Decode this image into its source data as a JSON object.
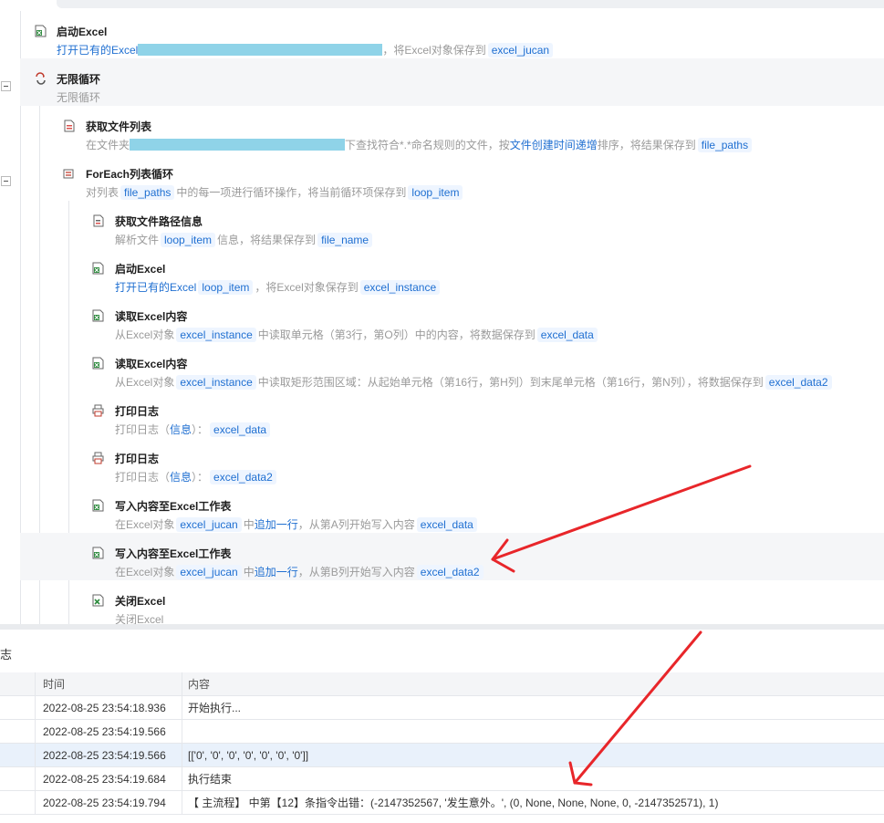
{
  "steps": [
    {
      "title": "启动Excel",
      "pre": "打开已有的Excel",
      "post": "，将Excel对象保存到",
      "tag": "excel_jucan"
    },
    {
      "title": "无限循环",
      "desc": "无限循环"
    },
    {
      "title": "获取文件列表",
      "pre": "在文件夹",
      "post": "下查找符合*.*命名规则的文件，按",
      "link": "文件创建时间递增",
      "post2": "排序，将结果保存到",
      "tag": "file_paths"
    },
    {
      "title": "ForEach列表循环",
      "pre": "对列表",
      "tag1": "file_paths",
      "mid": "中的每一项进行循环操作，将当前循环项保存到",
      "tag2": "loop_item"
    },
    {
      "title": "获取文件路径信息",
      "pre": "解析文件",
      "tag1": "loop_item",
      "mid": "信息，将结果保存到",
      "tag2": "file_name"
    },
    {
      "title": "启动Excel",
      "pre": "打开已有的Excel",
      "tag1": "loop_item",
      "mid": "，将Excel对象保存到",
      "tag2": "excel_instance"
    },
    {
      "title": "读取Excel内容",
      "pre": "从Excel对象",
      "tag1": "excel_instance",
      "mid": "中读取单元格（第3行，第O列）中的内容，将数据保存到",
      "tag2": "excel_data"
    },
    {
      "title": "读取Excel内容",
      "pre": "从Excel对象",
      "tag1": "excel_instance",
      "mid": "中读取矩形范围区域：从起始单元格（第16行，第H列）到末尾单元格（第16行，第N列），将数据保存到",
      "tag2": "excel_data2"
    },
    {
      "title": "打印日志",
      "pre": "打印日志（",
      "link": "信息",
      "mid": "）：",
      "tag": "excel_data"
    },
    {
      "title": "打印日志",
      "pre": "打印日志（",
      "link": "信息",
      "mid": "）：",
      "tag": "excel_data2"
    },
    {
      "title": "写入内容至Excel工作表",
      "pre": "在Excel对象",
      "tag1": "excel_jucan",
      "mid": "中",
      "link": "追加一行",
      "mid2": "，从第A列开始写入内容",
      "tag2": "excel_data"
    },
    {
      "title": "写入内容至Excel工作表",
      "pre": "在Excel对象",
      "tag1": "excel_jucan",
      "mid": "中",
      "link": "追加一行",
      "mid2": "，从第B列开始写入内容",
      "tag2": "excel_data2"
    },
    {
      "title": "关闭Excel",
      "desc": "关闭Excel"
    }
  ],
  "log": {
    "title": "志",
    "headers": {
      "time": "时间",
      "content": "内容"
    },
    "rows": [
      {
        "time": "2022-08-25 23:54:18.936",
        "content": "开始执行..."
      },
      {
        "time": "2022-08-25 23:54:19.566",
        "content": ""
      },
      {
        "time": "2022-08-25 23:54:19.566",
        "content": "[['0', '0', '0', '0', '0', '0', '0']]"
      },
      {
        "time": "2022-08-25 23:54:19.684",
        "content": "执行结束"
      },
      {
        "time": "2022-08-25 23:54:19.794",
        "content": "【 主流程】 中第【12】条指令出错：(-2147352567, '发生意外。', (0, None, None, None, 0, -2147352571), 1)"
      }
    ]
  },
  "colors": {
    "accent": "#1f6fd1",
    "tag_bg": "#eef5ff",
    "annotation": "#e8262a",
    "redaction": "#8fd3e8"
  },
  "icons": [
    "excel-file-icon",
    "loop-icon",
    "file-list-icon",
    "foreach-icon",
    "file-info-icon",
    "printer-icon",
    "excel-write-icon",
    "excel-close-icon"
  ]
}
